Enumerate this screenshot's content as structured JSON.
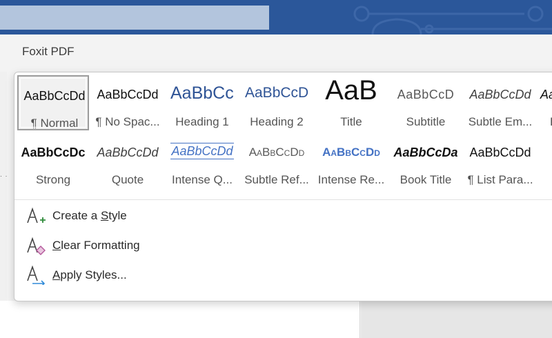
{
  "ribbon": {
    "active_tab": "Foxit PDF"
  },
  "ruler": {
    "dots": "· ·"
  },
  "styles": [
    {
      "name": "¶ Normal",
      "preview": "AaBbCcDd",
      "color": "#111111",
      "selected": true
    },
    {
      "name": "¶ No Spac...",
      "preview": "AaBbCcDd",
      "color": "#111111"
    },
    {
      "name": "Heading 1",
      "preview": "AaBbCc",
      "color": "#2f5496"
    },
    {
      "name": "Heading 2",
      "preview": "AaBbCcD",
      "color": "#2f5496"
    },
    {
      "name": "Title",
      "preview": "AaB",
      "color": "#111111"
    },
    {
      "name": "Subtitle",
      "preview": "AaBbCcD",
      "color": "#595959"
    },
    {
      "name": "Subtle Em...",
      "preview": "AaBbCcDd",
      "color": "#404040"
    },
    {
      "name": "E",
      "preview": "Aa",
      "color": "#111111"
    },
    {
      "name": "Strong",
      "preview": "AaBbCcDc",
      "color": "#111111"
    },
    {
      "name": "Quote",
      "preview": "AaBbCcDd",
      "color": "#404040"
    },
    {
      "name": "Intense Q...",
      "preview": "AaBbCcDd",
      "color": "#4472c4"
    },
    {
      "name": "Subtle Ref...",
      "preview": "AaBbCcDd",
      "color": "#5a5a5a"
    },
    {
      "name": "Intense Re...",
      "preview": "AaBbCcDd",
      "color": "#4472c4"
    },
    {
      "name": "Book Title",
      "preview": "AaBbCcDa",
      "color": "#111111"
    },
    {
      "name": "¶ List Para...",
      "preview": "AaBbCcDd",
      "color": "#111111"
    }
  ],
  "menu": {
    "create_style": {
      "pre": "Create a ",
      "key": "S",
      "post": "tyle"
    },
    "clear_formatting": {
      "pre": "",
      "key": "C",
      "post": "lear Formatting"
    },
    "apply_styles": {
      "pre": "",
      "key": "A",
      "post": "pply Styles..."
    }
  },
  "colors": {
    "titlebar": "#2b579a",
    "heading_blue": "#2f5496",
    "accent_blue": "#4472c4",
    "create_icon_plus": "#2e8b3a",
    "clear_icon_eraser": "#b4579a",
    "apply_icon_arrow": "#2f8ad8"
  }
}
